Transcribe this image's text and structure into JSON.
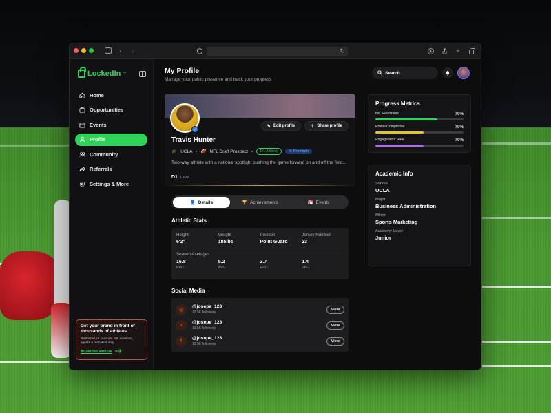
{
  "colors": {
    "accent": "#2fd35a",
    "readiness": "#2fd35a",
    "completion": "#e6c229",
    "engagement": "#b26be8",
    "promo_border": "#c24d3a"
  },
  "sidebar": {
    "brand": "LockedIn",
    "brand_sup": "™",
    "items": [
      {
        "label": "Home",
        "icon": "home-icon"
      },
      {
        "label": "Opportunities",
        "icon": "briefcase-icon"
      },
      {
        "label": "Events",
        "icon": "calendar-icon"
      },
      {
        "label": "Profile",
        "icon": "user-icon"
      },
      {
        "label": "Community",
        "icon": "people-icon"
      },
      {
        "label": "Referrals",
        "icon": "share-icon"
      },
      {
        "label": "Settings & More",
        "icon": "gear-icon"
      }
    ],
    "promo": {
      "title": "Get your brand in front of thousands of athletes.",
      "subtitle": "Restricted for coaches, NIL advisors , agents & recruiters only",
      "link": "Advertise with us"
    }
  },
  "header": {
    "title": "My Profile",
    "subtitle": "Manage your public presence and track your progress",
    "search_label": "Search"
  },
  "profile": {
    "name": "Travis Hunter",
    "school": "UCLA",
    "prospect": "NFL Draft Prospect",
    "tag_d1": "D1 Athlete",
    "tag_premium": "Premium",
    "bio": "Two-way athlete with a national spotlight pushing the game forward on and off the field...",
    "level_value": "D1",
    "level_label": "Level",
    "edit_label": "Edit profile",
    "share_label": "Share profile"
  },
  "tabs": [
    {
      "label": "Details"
    },
    {
      "label": "Achievements"
    },
    {
      "label": "Events"
    }
  ],
  "athletic": {
    "title": "Athletic Stats",
    "basic": [
      {
        "label": "Height",
        "value": "6'2\""
      },
      {
        "label": "Weight",
        "value": "185lbs"
      },
      {
        "label": "Position",
        "value": "Point Guard"
      },
      {
        "label": "Jersey Number",
        "value": "23"
      }
    ],
    "season_label": "Season Averages",
    "season": [
      {
        "value": "16.8",
        "unit": "PPG"
      },
      {
        "value": "5.2",
        "unit": "APG"
      },
      {
        "value": "3.7",
        "unit": "RPG"
      },
      {
        "value": "1.4",
        "unit": "SPG"
      }
    ]
  },
  "social": {
    "title": "Social Media",
    "view_label": "View",
    "accounts": [
      {
        "platform": "instagram-icon",
        "handle": "@josepe_123",
        "followers": "12.5K followers"
      },
      {
        "platform": "tiktok-icon",
        "handle": "@josepe_123",
        "followers": "12.5K followers"
      },
      {
        "platform": "facebook-icon",
        "handle": "@josepe_123",
        "followers": "12.5K followers"
      }
    ]
  },
  "progress": {
    "title": "Progress Metrics",
    "metrics": [
      {
        "label": "NIL Readiness",
        "value": "70%",
        "fraction": 0.7
      },
      {
        "label": "Profile Completion",
        "value": "70%",
        "fraction": 0.55
      },
      {
        "label": "Engagement Rate",
        "value": "70%",
        "fraction": 0.55
      }
    ]
  },
  "academic": {
    "title": "Academic Info",
    "fields": [
      {
        "label": "School",
        "value": "UCLA"
      },
      {
        "label": "Major",
        "value": "Business Administration"
      },
      {
        "label": "Minor",
        "value": "Sports Marketing"
      },
      {
        "label": "Academy Level",
        "value": "Junior"
      }
    ]
  }
}
